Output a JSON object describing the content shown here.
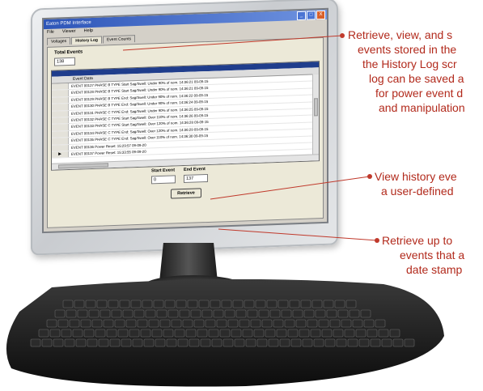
{
  "window": {
    "title": "Eaton PDM Interface",
    "menu": [
      "File",
      "Viewer",
      "Help"
    ],
    "controls": [
      "_",
      "□",
      "X"
    ]
  },
  "tabs": [
    {
      "label": "Voltages",
      "active": false
    },
    {
      "label": "History Log",
      "active": true
    },
    {
      "label": "Event Counts",
      "active": false
    }
  ],
  "history": {
    "total_events_label": "Total Events",
    "total_events_value": "138",
    "column_header": "Event Data",
    "rows": [
      "EVENT 00127  PHASE B TYPE Start Sag/Swell: Under  90% of nom. 14:36:21  09-09-15",
      "EVENT 00128  PHASE B TYPE Start Sag/Swell: Under  90% of nom. 14:36:21  09-09-15",
      "EVENT 00129  PHASE B TYPE End:   Sag/Swell: Under  90% of nom. 14:36:22  09-09-15",
      "EVENT 00130  PHASE B TYPE End:   Sag/Swell: Under  90% of nom. 14:36:24  09-09-15",
      "EVENT 00131  PHASE C TYPE End:   Sag/Swell: Under  90% of nom. 14:36:25  09-09-15",
      "EVENT 00132  PHASE C TYPE Start Sag/Swell: Over  110% of nom. 14:36:26  09-09-15",
      "EVENT 00133  PHASE C TYPE Start Sag/Swell: Over  120% of nom. 14:36:28  09-09-15",
      "EVENT 00134  PHASE C TYPE End:   Sag/Swell: Over  120% of nom. 14:36:29  09-09-15",
      "EVENT 00135  PHASE C TYPE End:   Sag/Swell: Over  110% of nom. 14:36:30  09-09-15",
      "EVENT 00136        Power Reset:                 15:29:57  09-09-20",
      "EVENT 00137        Power Reset:                 15:33:55  09-09-20"
    ],
    "start_event_label": "Start Event",
    "start_event_value": "0",
    "end_event_label": "End Event",
    "end_event_value": "137",
    "retrieve_button": "Retrieve"
  },
  "callouts": {
    "top": [
      "Retrieve, view, and s",
      "events stored in the",
      "the History Log scr",
      "log can be saved a",
      "for power event d",
      "and manipulation"
    ],
    "middle": [
      "View history eve",
      "a user-defined"
    ],
    "bottom": [
      "Retrieve up to",
      "events that a",
      "date stamp"
    ]
  },
  "colors": {
    "callout_text": "#b22a1c",
    "title_bar": "#2d55b8",
    "grid_header": "#1f3d8c"
  }
}
